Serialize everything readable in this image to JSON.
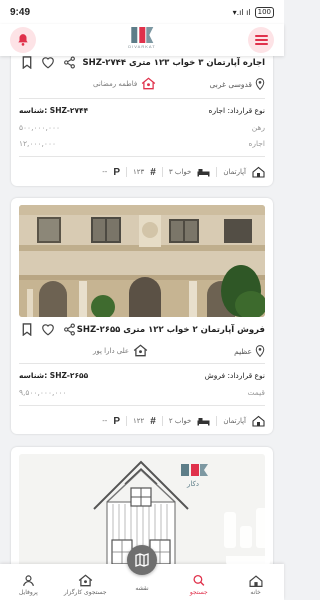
{
  "status_bar": {
    "time": "9:49",
    "signal": "▾.ıl ıl",
    "battery": "100"
  },
  "app_bar": {
    "logo_caption": "DIVARKAT"
  },
  "listings": [
    {
      "title": "اجاره آپارتمان ۳ خواب ۱۲۳ متری SHZ-۲۷۴۴",
      "location": "قدوسی غربی",
      "agent": "فاطمه رمضانی",
      "contract_label": "نوع قرارداد: اجاره",
      "code_label": "شناسه: SHZ-۲۷۴۴",
      "price_rows": [
        {
          "label": "رهن",
          "value": "۵۰۰,۰۰۰,۰۰۰"
        },
        {
          "label": "اجاره",
          "value": "۱۲,۰۰۰,۰۰۰"
        }
      ],
      "features": {
        "type": "آپارتمان",
        "rooms": "۳ خواب",
        "area": "۱۲۳",
        "parking": "--"
      }
    },
    {
      "title": "فروش آپارتمان ۲ خواب ۱۲۲ متری SHZ-۲۶۵۵",
      "location": "عظیم",
      "agent": "علی دارا پور",
      "contract_label": "نوع قرارداد: فروش",
      "code_label": "شناسه: SHZ-۲۶۵۵",
      "price_rows": [
        {
          "label": "قیمت",
          "value": "۹,۵۰۰,۰۰۰,۰۰۰"
        }
      ],
      "features": {
        "type": "آپارتمان",
        "rooms": "۲ خواب",
        "area": "۱۲۲",
        "parking": "--"
      }
    },
    {
      "photo_brand": "دکار"
    }
  ],
  "bottom_nav": {
    "items": [
      {
        "label": "خانه",
        "icon": "home-icon"
      },
      {
        "label": "جستجو",
        "icon": "search-icon",
        "active": true
      },
      {
        "label": "نقشه",
        "icon": "map-icon"
      },
      {
        "label": "جستجوی کارگزار",
        "icon": "agent-search-icon"
      },
      {
        "label": "پروفایل",
        "icon": "profile-icon"
      }
    ]
  },
  "colors": {
    "accent": "#e0314b",
    "logo_teal": "#5d7d88",
    "fab": "#6f6f6f"
  }
}
